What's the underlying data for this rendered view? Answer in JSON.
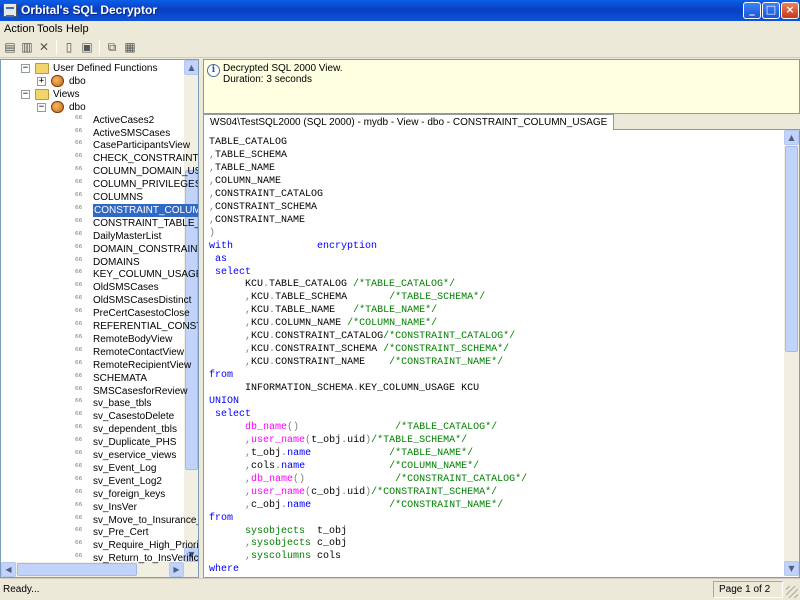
{
  "window": {
    "title": "Orbital's SQL Decryptor",
    "controls": [
      "_",
      "□",
      "×"
    ]
  },
  "menu": {
    "items": [
      {
        "label": "Action"
      },
      {
        "label": "Tools"
      },
      {
        "label": "Help"
      }
    ]
  },
  "toolbar": {
    "buttons": [
      {
        "icon": "new-connection-icon"
      },
      {
        "icon": "properties-icon"
      },
      {
        "icon": "delete-icon"
      },
      {
        "icon": "decrypt-icon"
      },
      {
        "icon": "print-icon"
      },
      {
        "icon": "copy-icon"
      },
      {
        "icon": "export-icon"
      }
    ]
  },
  "tree": {
    "nodes": [
      {
        "label": "User Defined Functions",
        "type": "folder",
        "expander": "−"
      },
      {
        "label": "dbo",
        "type": "schema",
        "expander": "+"
      },
      {
        "label": "Views",
        "type": "folder",
        "expander": "−"
      },
      {
        "label": "dbo",
        "type": "schema",
        "expander": "−"
      },
      {
        "label": "ActiveCases2",
        "type": "view"
      },
      {
        "label": "ActiveSMSCases",
        "type": "view"
      },
      {
        "label": "CaseParticipantsView",
        "type": "view"
      },
      {
        "label": "CHECK_CONSTRAINTS",
        "type": "view"
      },
      {
        "label": "COLUMN_DOMAIN_US",
        "type": "view"
      },
      {
        "label": "COLUMN_PRIVILEGES",
        "type": "view"
      },
      {
        "label": "COLUMNS",
        "type": "view"
      },
      {
        "label": "CONSTRAINT_COLUM",
        "type": "view",
        "selected": true
      },
      {
        "label": "CONSTRAINT_TABLE_",
        "type": "view"
      },
      {
        "label": "DailyMasterList",
        "type": "view"
      },
      {
        "label": "DOMAIN_CONSTRAINT",
        "type": "view"
      },
      {
        "label": "DOMAINS",
        "type": "view"
      },
      {
        "label": "KEY_COLUMN_USAGE",
        "type": "view"
      },
      {
        "label": "OldSMSCases",
        "type": "view"
      },
      {
        "label": "OldSMSCasesDistinct",
        "type": "view"
      },
      {
        "label": "PreCertCasestoClose",
        "type": "view"
      },
      {
        "label": "REFERENTIAL_CONST",
        "type": "view"
      },
      {
        "label": "RemoteBodyView",
        "type": "view"
      },
      {
        "label": "RemoteContactView",
        "type": "view"
      },
      {
        "label": "RemoteRecipientView",
        "type": "view"
      },
      {
        "label": "SCHEMATA",
        "type": "view"
      },
      {
        "label": "SMSCasesforReview",
        "type": "view"
      },
      {
        "label": "sv_base_tbls",
        "type": "view"
      },
      {
        "label": "sv_CasestoDelete",
        "type": "view"
      },
      {
        "label": "sv_dependent_tbls",
        "type": "view"
      },
      {
        "label": "sv_Duplicate_PHS",
        "type": "view"
      },
      {
        "label": "sv_eservice_views",
        "type": "view"
      },
      {
        "label": "sv_Event_Log",
        "type": "view"
      },
      {
        "label": "sv_Event_Log2",
        "type": "view"
      },
      {
        "label": "sv_foreign_keys",
        "type": "view"
      },
      {
        "label": "sv_InsVer",
        "type": "view"
      },
      {
        "label": "sv_Move_to_Insurance_",
        "type": "view"
      },
      {
        "label": "sv_Pre_Cert",
        "type": "view"
      },
      {
        "label": "sv_Require_High_Priorit",
        "type": "view"
      },
      {
        "label": "sv_Return_to_InsVerific",
        "type": "view"
      }
    ]
  },
  "message": {
    "line1": "Decrypted SQL 2000 View.",
    "line2": "Duration: 3 seconds"
  },
  "tab": {
    "label": "WS04\\TestSQL2000 (SQL 2000) - mydb - View - dbo - CONSTRAINT_COLUMN_USAGE"
  },
  "code": {
    "lines": [
      [
        [
          "TABLE_CATALOG",
          ""
        ]
      ],
      [
        [
          ",",
          "p"
        ],
        [
          "TABLE_SCHEMA",
          ""
        ]
      ],
      [
        [
          ",",
          "p"
        ],
        [
          "TABLE_NAME",
          ""
        ]
      ],
      [
        [
          ",",
          "p"
        ],
        [
          "COLUMN_NAME",
          ""
        ]
      ],
      [
        [
          ",",
          "p"
        ],
        [
          "CONSTRAINT_CATALOG",
          ""
        ]
      ],
      [
        [
          ",",
          "p"
        ],
        [
          "CONSTRAINT_SCHEMA",
          ""
        ]
      ],
      [
        [
          ",",
          "p"
        ],
        [
          "CONSTRAINT_NAME",
          ""
        ]
      ],
      [
        [
          ")",
          "p"
        ]
      ],
      [
        [
          "with",
          "k"
        ],
        [
          "              ",
          ""
        ],
        [
          "encryption",
          "k"
        ]
      ],
      [
        [
          " as",
          "k"
        ]
      ],
      [
        [
          " select",
          "k"
        ]
      ],
      [
        [
          "      KCU",
          ""
        ],
        [
          ".",
          "p"
        ],
        [
          "TABLE_CATALOG ",
          ""
        ],
        [
          "/*TABLE_CATALOG*/",
          "c"
        ]
      ],
      [
        [
          "      ",
          ""
        ],
        [
          ",",
          "p"
        ],
        [
          "KCU",
          ""
        ],
        [
          ".",
          "p"
        ],
        [
          "TABLE_SCHEMA       ",
          ""
        ],
        [
          "/*TABLE_SCHEMA*/",
          "c"
        ]
      ],
      [
        [
          "      ",
          ""
        ],
        [
          ",",
          "p"
        ],
        [
          "KCU",
          ""
        ],
        [
          ".",
          "p"
        ],
        [
          "TABLE_NAME   ",
          ""
        ],
        [
          "/*TABLE_NAME*/",
          "c"
        ]
      ],
      [
        [
          "      ",
          ""
        ],
        [
          ",",
          "p"
        ],
        [
          "KCU",
          ""
        ],
        [
          ".",
          "p"
        ],
        [
          "COLUMN_NAME ",
          ""
        ],
        [
          "/*COLUMN_NAME*/",
          "c"
        ]
      ],
      [
        [
          "      ",
          ""
        ],
        [
          ",",
          "p"
        ],
        [
          "KCU",
          ""
        ],
        [
          ".",
          "p"
        ],
        [
          "CONSTRAINT_CATALOG",
          ""
        ],
        [
          "/*CONSTRAINT_CATALOG*/",
          "c"
        ]
      ],
      [
        [
          "      ",
          ""
        ],
        [
          ",",
          "p"
        ],
        [
          "KCU",
          ""
        ],
        [
          ".",
          "p"
        ],
        [
          "CONSTRAINT_SCHEMA ",
          ""
        ],
        [
          "/*CONSTRAINT_SCHEMA*/",
          "c"
        ]
      ],
      [
        [
          "      ",
          ""
        ],
        [
          ",",
          "p"
        ],
        [
          "KCU",
          ""
        ],
        [
          ".",
          "p"
        ],
        [
          "CONSTRAINT_NAME    ",
          ""
        ],
        [
          "/*CONSTRAINT_NAME*/",
          "c"
        ]
      ],
      [
        [
          "from",
          "k"
        ]
      ],
      [
        [
          "      INFORMATION_SCHEMA",
          ""
        ],
        [
          ".",
          "p"
        ],
        [
          "KEY_COLUMN_USAGE KCU",
          ""
        ]
      ],
      [
        [
          "UNION",
          "k"
        ]
      ],
      [
        [
          " select",
          "k"
        ]
      ],
      [
        [
          "      ",
          ""
        ],
        [
          "db_name",
          "f"
        ],
        [
          "()",
          "p"
        ],
        [
          "                ",
          ""
        ],
        [
          "/*TABLE_CATALOG*/",
          "c"
        ]
      ],
      [
        [
          "      ",
          ""
        ],
        [
          ",",
          "p"
        ],
        [
          "user_name",
          "f"
        ],
        [
          "(",
          "p"
        ],
        [
          "t_obj",
          ""
        ],
        [
          ".",
          "p"
        ],
        [
          "uid",
          ""
        ],
        [
          ")",
          "p"
        ],
        [
          "/*TABLE_SCHEMA*/",
          "c"
        ]
      ],
      [
        [
          "      ",
          ""
        ],
        [
          ",",
          "p"
        ],
        [
          "t_obj",
          ""
        ],
        [
          ".",
          "p"
        ],
        [
          "name",
          "k"
        ],
        [
          "             ",
          ""
        ],
        [
          "/*TABLE_NAME*/",
          "c"
        ]
      ],
      [
        [
          "      ",
          ""
        ],
        [
          ",",
          "p"
        ],
        [
          "cols",
          ""
        ],
        [
          ".",
          "p"
        ],
        [
          "name",
          "k"
        ],
        [
          "              ",
          ""
        ],
        [
          "/*COLUMN_NAME*/",
          "c"
        ]
      ],
      [
        [
          "      ",
          ""
        ],
        [
          ",",
          "p"
        ],
        [
          "db_name",
          "f"
        ],
        [
          "()",
          "p"
        ],
        [
          "               ",
          ""
        ],
        [
          "/*CONSTRAINT_CATALOG*/",
          "c"
        ]
      ],
      [
        [
          "      ",
          ""
        ],
        [
          ",",
          "p"
        ],
        [
          "user_name",
          "f"
        ],
        [
          "(",
          "p"
        ],
        [
          "c_obj",
          ""
        ],
        [
          ".",
          "p"
        ],
        [
          "uid",
          ""
        ],
        [
          ")",
          "p"
        ],
        [
          "/*CONSTRAINT_SCHEMA*/",
          "c"
        ]
      ],
      [
        [
          "      ",
          ""
        ],
        [
          ",",
          "p"
        ],
        [
          "c_obj",
          ""
        ],
        [
          ".",
          "p"
        ],
        [
          "name",
          "k"
        ],
        [
          "             ",
          ""
        ],
        [
          "/*CONSTRAINT_NAME*/",
          "c"
        ]
      ],
      [
        [
          "from",
          "k"
        ]
      ],
      [
        [
          "      ",
          ""
        ],
        [
          "sysobjects",
          "c"
        ],
        [
          "  t_obj",
          ""
        ]
      ],
      [
        [
          "      ",
          ""
        ],
        [
          ",",
          "p"
        ],
        [
          "sysobjects",
          "c"
        ],
        [
          " c_obj",
          ""
        ]
      ],
      [
        [
          "      ",
          ""
        ],
        [
          ",",
          "p"
        ],
        [
          "syscolumns",
          "c"
        ],
        [
          " cols",
          ""
        ]
      ],
      [
        [
          "where",
          "k"
        ]
      ]
    ]
  },
  "status": {
    "text": "Ready...",
    "page": "Page 1 of 2"
  }
}
